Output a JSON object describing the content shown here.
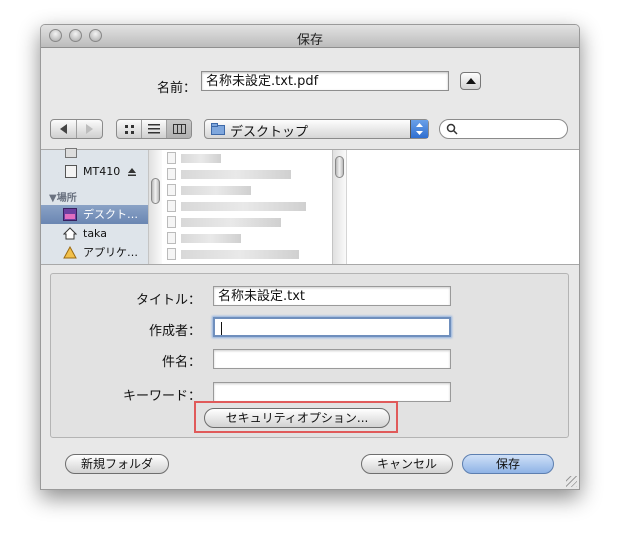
{
  "window": {
    "title": "保存"
  },
  "save_as": {
    "label": "名前：",
    "value": "名称未設定.txt.pdf"
  },
  "toolbar": {
    "location": "デスクトップ",
    "search_placeholder": ""
  },
  "sidebar": {
    "devices": [
      {
        "label": "MT410",
        "icon": "drive-icon"
      }
    ],
    "places_header": "▼場所",
    "places": [
      {
        "label": "デスクト…",
        "icon": "desktop-folder-icon",
        "selected": true
      },
      {
        "label": "taka",
        "icon": "home-icon",
        "selected": false
      },
      {
        "label": "アプリケ…",
        "icon": "applications-icon",
        "selected": false
      }
    ]
  },
  "fields": {
    "title_label": "タイトル：",
    "title_value": "名称未設定.txt",
    "author_label": "作成者：",
    "author_value": "",
    "subject_label": "件名：",
    "subject_value": "",
    "keywords_label": "キーワード：",
    "keywords_value": ""
  },
  "buttons": {
    "security": "セキュリティオプション...",
    "new_folder": "新規フォルダ",
    "cancel": "キャンセル",
    "save": "保存"
  }
}
